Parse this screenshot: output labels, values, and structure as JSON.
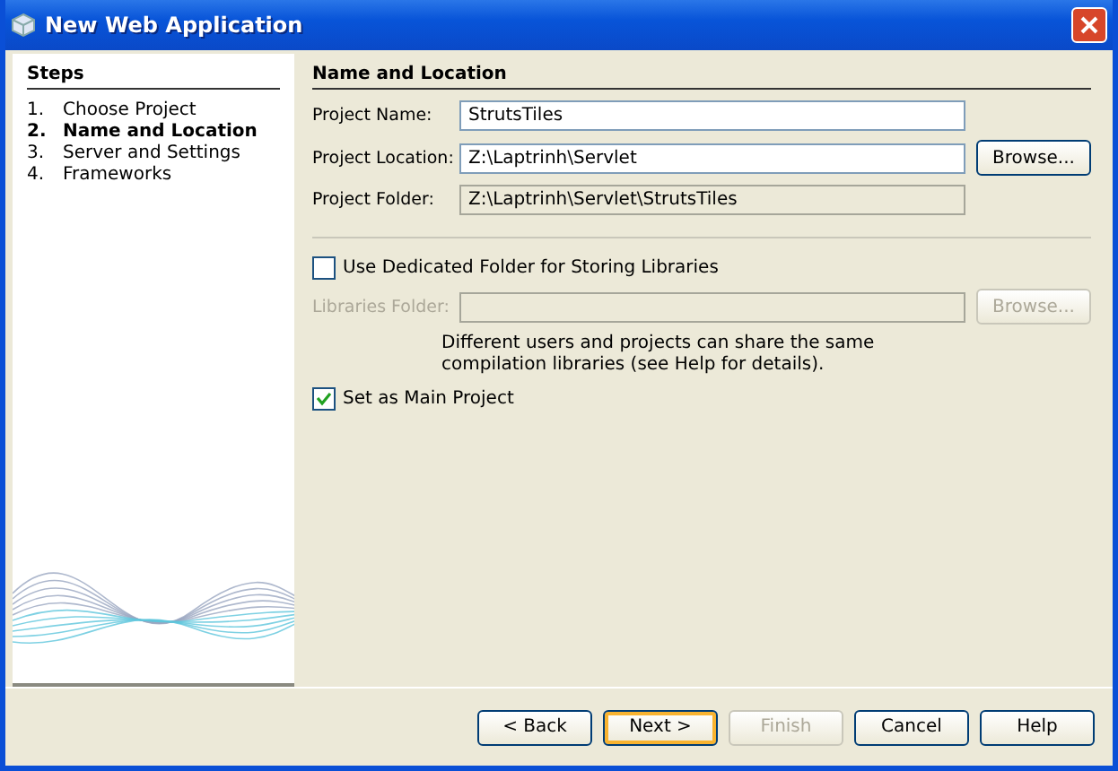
{
  "window": {
    "title": "New Web Application"
  },
  "steps": {
    "title": "Steps",
    "items": [
      {
        "number": "1.",
        "label": "Choose Project",
        "selected": false
      },
      {
        "number": "2.",
        "label": "Name and Location",
        "selected": true
      },
      {
        "number": "3.",
        "label": "Server and Settings",
        "selected": false
      },
      {
        "number": "4.",
        "label": "Frameworks",
        "selected": false
      }
    ]
  },
  "panel": {
    "title": "Name and Location",
    "fields": [
      {
        "label": "Project Name:",
        "value": "StrutsTiles",
        "disabled": false
      },
      {
        "label": "Project Location:",
        "value": "Z:\\Laptrinh\\Servlet",
        "disabled": false,
        "button": {
          "label": "Browse...",
          "disabled": false
        }
      },
      {
        "label": "Project Folder:",
        "value": "Z:\\Laptrinh\\Servlet\\StrutsTiles",
        "disabled": true
      }
    ],
    "dedicated": {
      "label": "Use Dedicated Folder for Storing Libraries",
      "checked": false
    },
    "libraries": {
      "label": "Libraries Folder:",
      "disabled": true,
      "button": {
        "label": "Browse...",
        "disabled": true
      }
    },
    "note": "Different users and projects can share the same compilation libraries (see Help for details).",
    "main_project": {
      "label": "Set as Main Project",
      "checked": true
    }
  },
  "buttons": [
    {
      "label": "< Back",
      "disabled": false,
      "focused": false
    },
    {
      "label": "Next >",
      "disabled": false,
      "focused": true
    },
    {
      "label": "Finish",
      "disabled": true,
      "focused": false
    },
    {
      "label": "Cancel",
      "disabled": false,
      "focused": false
    },
    {
      "label": "Help",
      "disabled": false,
      "focused": false
    }
  ]
}
